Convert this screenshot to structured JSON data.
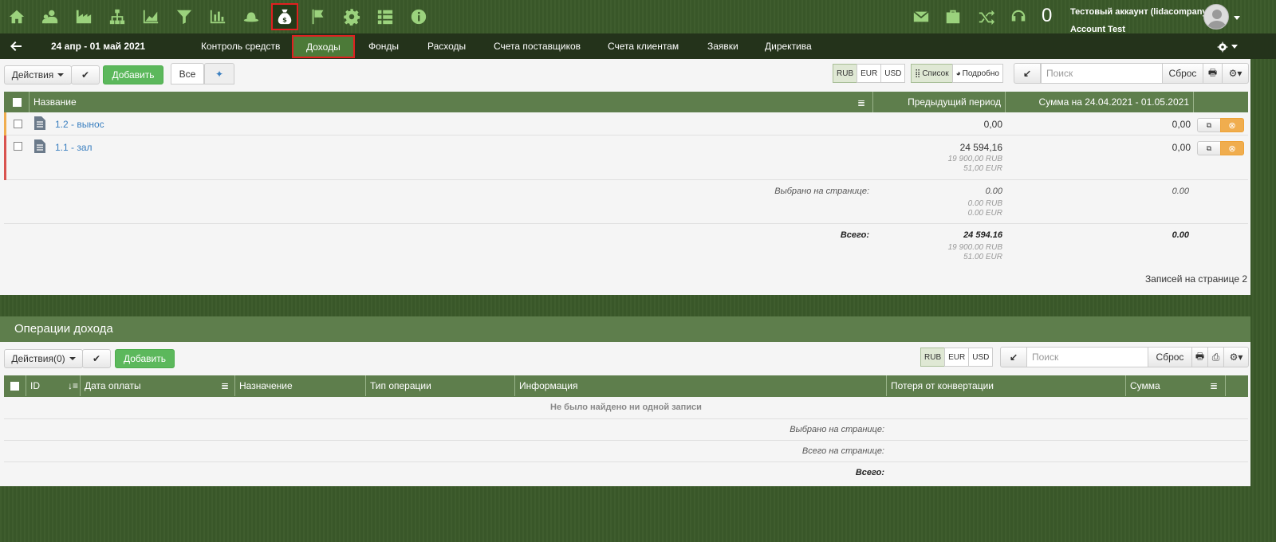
{
  "account": {
    "name": "Тестовый аккаунт (lidacompany)",
    "user": "Account Test",
    "counter": "0"
  },
  "nav": {
    "period": "24 апр - 01 май 2021",
    "tabs": [
      "Контроль средств",
      "Доходы",
      "Фонды",
      "Расходы",
      "Счета поставщиков",
      "Счета клиентам",
      "Заявки",
      "Директива"
    ],
    "active_tab": "Доходы"
  },
  "top_icons": [
    "home-icon",
    "users-icon",
    "factory-icon",
    "hierarchy-icon",
    "area-chart-icon",
    "filter-icon",
    "bar-chart-icon",
    "hat-icon",
    "money-bag-icon",
    "flag-icon",
    "gear-icon",
    "list-icon",
    "info-icon"
  ],
  "colors": {
    "accent_green": "#5cb85c",
    "header_green": "#5e7e4c",
    "nav_dark": "#24331b",
    "highlight": "#e02020",
    "orange_stripe": "#f0ad4e",
    "red_stripe": "#d9534f",
    "link": "#3a7fc0"
  },
  "income": {
    "actions_label": "Действия",
    "add_label": "Добавить",
    "filter_all": "Все",
    "currencies": [
      "RUB",
      "EUR",
      "USD"
    ],
    "view_list": "Список",
    "view_detail": "Подробно",
    "search_placeholder": "Поиск",
    "reset_label": "Сброс",
    "columns": {
      "name": "Название",
      "previous": "Предыдущий период",
      "sum": "Сумма на 24.04.2021 - 01.05.2021"
    },
    "rows": [
      {
        "name": "1.2 - вынос",
        "previous": "0,00",
        "previous_rub": "",
        "previous_eur": "",
        "sum": "0,00"
      },
      {
        "name": "1.1 - зал",
        "previous": "24 594,16",
        "previous_rub": "19 900,00 RUB",
        "previous_eur": "51,00 EUR",
        "sum": "0,00"
      }
    ],
    "selected": {
      "label": "Выбрано на странице:",
      "previous": "0.00",
      "previous_rub": "0.00 RUB",
      "previous_eur": "0.00 EUR",
      "sum": "0.00"
    },
    "total": {
      "label": "Всего:",
      "previous": "24 594.16",
      "previous_rub": "19 900.00 RUB",
      "previous_eur": "51.00 EUR",
      "sum": "0.00"
    },
    "records_per_page": "Записей на странице 2"
  },
  "operations": {
    "title": "Операции дохода",
    "actions_label": "Действия(0)",
    "add_label": "Добавить",
    "currencies": [
      "RUB",
      "EUR",
      "USD"
    ],
    "search_placeholder": "Поиск",
    "reset_label": "Сброс",
    "columns": [
      "ID",
      "Дата оплаты",
      "Назначение",
      "Тип операции",
      "Информация",
      "Потеря от конвертации",
      "Сумма"
    ],
    "empty": "Не было найдено ни одной записи",
    "selected_label": "Выбрано на странице:",
    "page_total_label": "Всего на странице:",
    "total_label": "Всего:"
  }
}
